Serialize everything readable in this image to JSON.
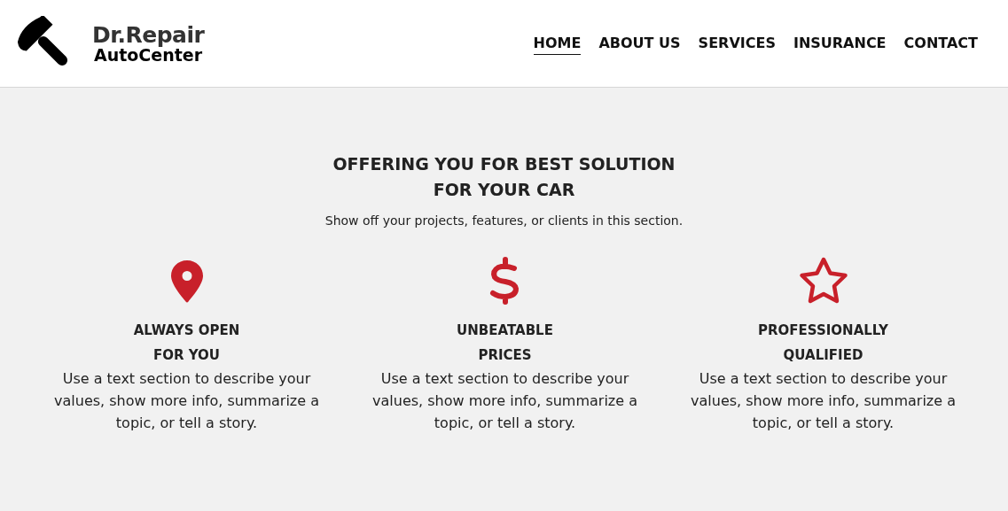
{
  "header": {
    "logo": {
      "name": "Dr.Repair",
      "subtitle": "AutoCenter"
    },
    "nav": [
      {
        "label": "HOME",
        "selected": true
      },
      {
        "label": "ABOUT US",
        "selected": false
      },
      {
        "label": "SERVICES",
        "selected": false
      },
      {
        "label": "INSURANCE",
        "selected": false
      },
      {
        "label": "CONTACT",
        "selected": false
      }
    ]
  },
  "section": {
    "title_lines": [
      "OFFERING YOU FOR BEST SOLUTION",
      "FOR YOUR CAR"
    ],
    "subtitle": "Show off your projects, features, or clients in this section.",
    "features": [
      {
        "kind": "pin",
        "title_lines": [
          "ALWAYS OPEN",
          "FOR YOU"
        ],
        "text": "Use a text section to describe your values, show more info, summarize a topic, or tell a story."
      },
      {
        "kind": "dollar",
        "title_lines": [
          "UNBEATABLE",
          "PRICES"
        ],
        "text": "Use a text section to describe your values, show more info, summarize a topic, or tell a story."
      },
      {
        "kind": "star",
        "title_lines": [
          "PROFESSIONALLY",
          "QUALIFIED"
        ],
        "text": "Use a text section to describe your values, show more info, summarize a topic, or tell a story."
      }
    ]
  }
}
